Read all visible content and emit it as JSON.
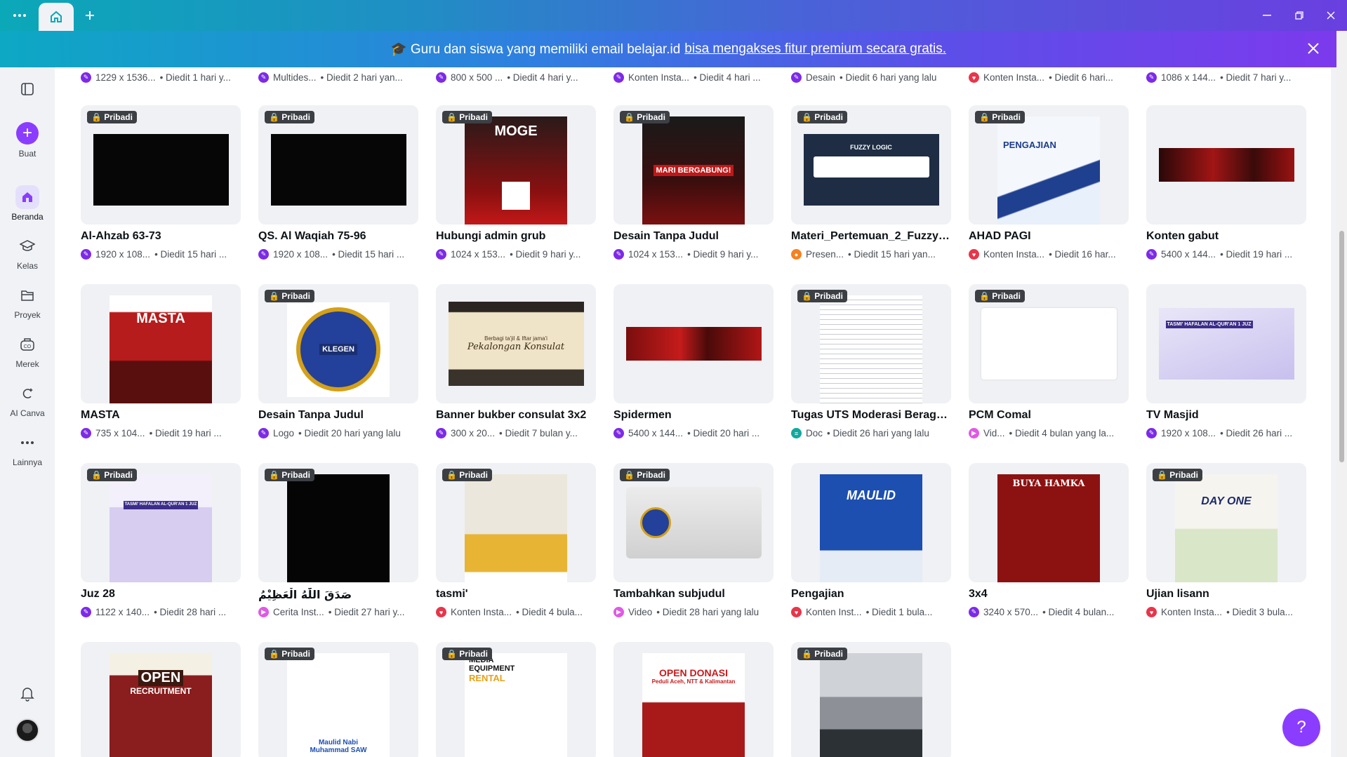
{
  "banner": {
    "text": "🎓 Guru dan siswa yang memiliki email belajar.id",
    "link": "bisa mengakses fitur premium secara gratis."
  },
  "sidebar": {
    "items": [
      {
        "label": "Buat"
      },
      {
        "label": "Beranda"
      },
      {
        "label": "Kelas"
      },
      {
        "label": "Proyek"
      },
      {
        "label": "Merek"
      },
      {
        "label": "AI Canva"
      },
      {
        "label": "Lainnya"
      }
    ]
  },
  "badge": "🔒 Pribadi",
  "top_row": [
    {
      "m1": "1229 x 1536...",
      "m2": "• Diedit 1 hari y..."
    },
    {
      "m1": "Multides...",
      "m2": "• Diedit 2 hari yan..."
    },
    {
      "m1": "800 x 500 ...",
      "m2": "• Diedit 4 hari y..."
    },
    {
      "m1": "Konten Insta...",
      "m2": "• Diedit 4 hari ..."
    },
    {
      "m1": "Desain",
      "m2": "• Diedit 6 hari yang lalu"
    },
    {
      "m1": "Konten Insta...",
      "m2": "• Diedit 6 hari..."
    },
    {
      "m1": "1086 x 144...",
      "m2": "• Diedit 7 hari y..."
    }
  ],
  "rows": [
    [
      {
        "title": "Al-Ahzab 63-73",
        "m1": "1920 x 108...",
        "m2": "• Diedit 15 hari ..."
      },
      {
        "title": "QS. Al Waqiah 75-96",
        "m1": "1920 x 108...",
        "m2": "• Diedit 15 hari ..."
      },
      {
        "title": "Hubungi admin grub",
        "m1": "1024 x 153...",
        "m2": "• Diedit 9 hari y..."
      },
      {
        "title": "Desain Tanpa Judul",
        "m1": "1024 x 153...",
        "m2": "• Diedit 9 hari y..."
      },
      {
        "title": "Materi_Pertemuan_2_Fuzzy_...",
        "m1": "Presen...",
        "m2": "• Diedit 15 hari yan..."
      },
      {
        "title": "AHAD PAGI",
        "m1": "Konten Insta...",
        "m2": "• Diedit 16 har..."
      },
      {
        "title": "Konten gabut",
        "m1": "5400 x 144...",
        "m2": "• Diedit 19 hari ..."
      }
    ],
    [
      {
        "title": "MASTA",
        "m1": "735 x 104...",
        "m2": "• Diedit 19 hari ..."
      },
      {
        "title": "Desain Tanpa Judul",
        "m1": "Logo",
        "m2": "• Diedit 20 hari yang lalu"
      },
      {
        "title": "Banner bukber consulat 3x2",
        "m1": "300 x 20...",
        "m2": "• Diedit 7 bulan y..."
      },
      {
        "title": "Spidermen",
        "m1": "5400 x 144...",
        "m2": "• Diedit 20 hari ..."
      },
      {
        "title": "Tugas UTS Moderasi Beraga...",
        "m1": "Doc",
        "m2": "• Diedit 26 hari yang lalu"
      },
      {
        "title": "PCM Comal",
        "m1": "Vid...",
        "m2": "• Diedit 4 bulan yang la..."
      },
      {
        "title": "TV Masjid",
        "m1": "1920 x 108...",
        "m2": "• Diedit 26 hari ..."
      }
    ],
    [
      {
        "title": "Juz 28",
        "m1": "1122 x 140...",
        "m2": "• Diedit 28 hari ..."
      },
      {
        "title": "صَدَقَ اللّٰهُ الْعَظِيْمُ",
        "m1": "Cerita Inst...",
        "m2": "• Diedit 27 hari y..."
      },
      {
        "title": "tasmi'",
        "m1": "Konten Insta...",
        "m2": "• Diedit 4 bula..."
      },
      {
        "title": "Tambahkan subjudul",
        "m1": "Video",
        "m2": "• Diedit 28 hari yang lalu"
      },
      {
        "title": "Pengajian",
        "m1": "Konten Inst...",
        "m2": "• Diedit 1 bula..."
      },
      {
        "title": "3x4",
        "m1": "3240 x 570...",
        "m2": "• Diedit 4 bulan..."
      },
      {
        "title": "Ujian lisann",
        "m1": "Konten Insta...",
        "m2": "• Diedit 3 bula..."
      }
    ]
  ],
  "thumb_text": {
    "moge": "MOGE",
    "mari": "MARI BERGABUNG!",
    "fuzzy": "FUZZY LOGIC",
    "pengajian": "PENGAJIAN",
    "masta": "MASTA",
    "klegen": "KLEGEN",
    "banner_title": "Pekalongan Konsulat",
    "banner_sub": "Berbagi ta'jil & Iftar jama'i",
    "tasmi": "TASMI' HAFALAN AL-QUR'AN 1 JUZ",
    "maulid": "MAULID",
    "buya": "BUYA HAMKA",
    "day_one": "DAY ONE",
    "open": "OPEN",
    "recruitment": "RECRUITMENT",
    "maulid_nabi": "Maulid Nabi Muhammad SAW",
    "media": "MEDIA EQUIPMENT",
    "rental": "RENTAL",
    "open_donasi": "OPEN DONASI",
    "peduli": "Peduli Aceh, NTT & Kalimantan"
  },
  "help": "?"
}
